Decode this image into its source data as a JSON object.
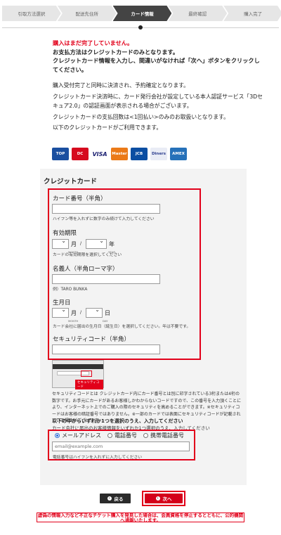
{
  "steps": [
    {
      "label": "引取方法選択",
      "active": false
    },
    {
      "label": "配送先住所",
      "active": false
    },
    {
      "label": "カード情報",
      "active": true
    },
    {
      "label": "最終確認",
      "active": false
    },
    {
      "label": "購入完了",
      "active": false
    }
  ],
  "notice": {
    "red": "購入はまだ完了していません。",
    "line1": "お支払方法はクレジットカードのみとなります。",
    "line2": "クレジットカード情報を入力し、間違いがなければ「次へ」ボタンをクリックしてください。"
  },
  "info": {
    "p1": "購入受付完了と同時に決済され、予約確定となります。",
    "p2": "クレジットカード決済時に、カード発行会社が設定している本人認証サービス「3Dセキュア2.0」の認証画面が表示される場合がございます。",
    "p3": "クレジットカードの支払回数は<1回払い>のみのお取扱いとなります。",
    "p4": "以下のクレジットカードがご利用できます。"
  },
  "cards": [
    {
      "name": "TOP",
      "color": "#1a4fa0"
    },
    {
      "name": "DC",
      "color": "#d60a1e"
    },
    {
      "name": "VISA",
      "color": "#1a1f71"
    },
    {
      "name": "Master",
      "color": "#eb7a18"
    },
    {
      "name": "JCB",
      "color": "#0b4ea2"
    },
    {
      "name": "Diners",
      "color": "#2e3f8f"
    },
    {
      "name": "AMEX",
      "color": "#2671b9"
    }
  ],
  "form": {
    "title": "クレジットカード",
    "card_number_label": "カード番号（半角）",
    "card_number_hint": "ハイフン等を入れずに数字のみ続けて入力してください",
    "expiry_label": "有効期限",
    "month_unit": "月",
    "year_unit": "年",
    "month_caption": "MONTH",
    "year_caption": "YEAR",
    "expiry_hint": "カードの有効期限を選択してください",
    "holder_label": "名義人（半角ローマ字）",
    "holder_hint": "例）TARO BUNKA",
    "birth_label": "生月日",
    "day_unit": "日",
    "day_caption": "DAY",
    "birth_hint": "カード会社に届出の生月日（誕生日）を選択してください。年は不要です。",
    "cvv_label": "セキュリティコード（半角）",
    "cvv_tag": "セキュリティコード",
    "cvv_desc": "セキュリティコードとは クレジットカード内にカード番号とは別に印字されている3桁または4桁の数字です。お手元にカードがあるお客様しかわからないコードですので、この番号を入力頂くことにより、インターネット上でのご購入の際のセキュリティを高めることができます。※セキュリティコードはお客様の暗証番号ではありません。※一部のカードでは表面にセキュリティコードが記載されている場合がございます。",
    "select_head": "以下の中からいずれか1つを選択のうえ、入力してください",
    "select_sub": "カード会社に届出のお客様情報をいずれか1つ選択のうえ、入力してください",
    "radios": [
      {
        "label": "メールアドレス",
        "checked": true
      },
      {
        "label": "電話番号",
        "checked": false
      },
      {
        "label": "携帯電話番号",
        "checked": false
      }
    ],
    "contact_placeholder": "email@example.com",
    "contact_hint": "電話番号はハイフンを入れずに入力してください"
  },
  "buttons": {
    "back": "戻る",
    "next": "次へ"
  },
  "warning": "虚偽の情報入力など不正なチケット購入を発見した場合は、会員資格を停止するとともに、公的機関へ通報いたします。"
}
